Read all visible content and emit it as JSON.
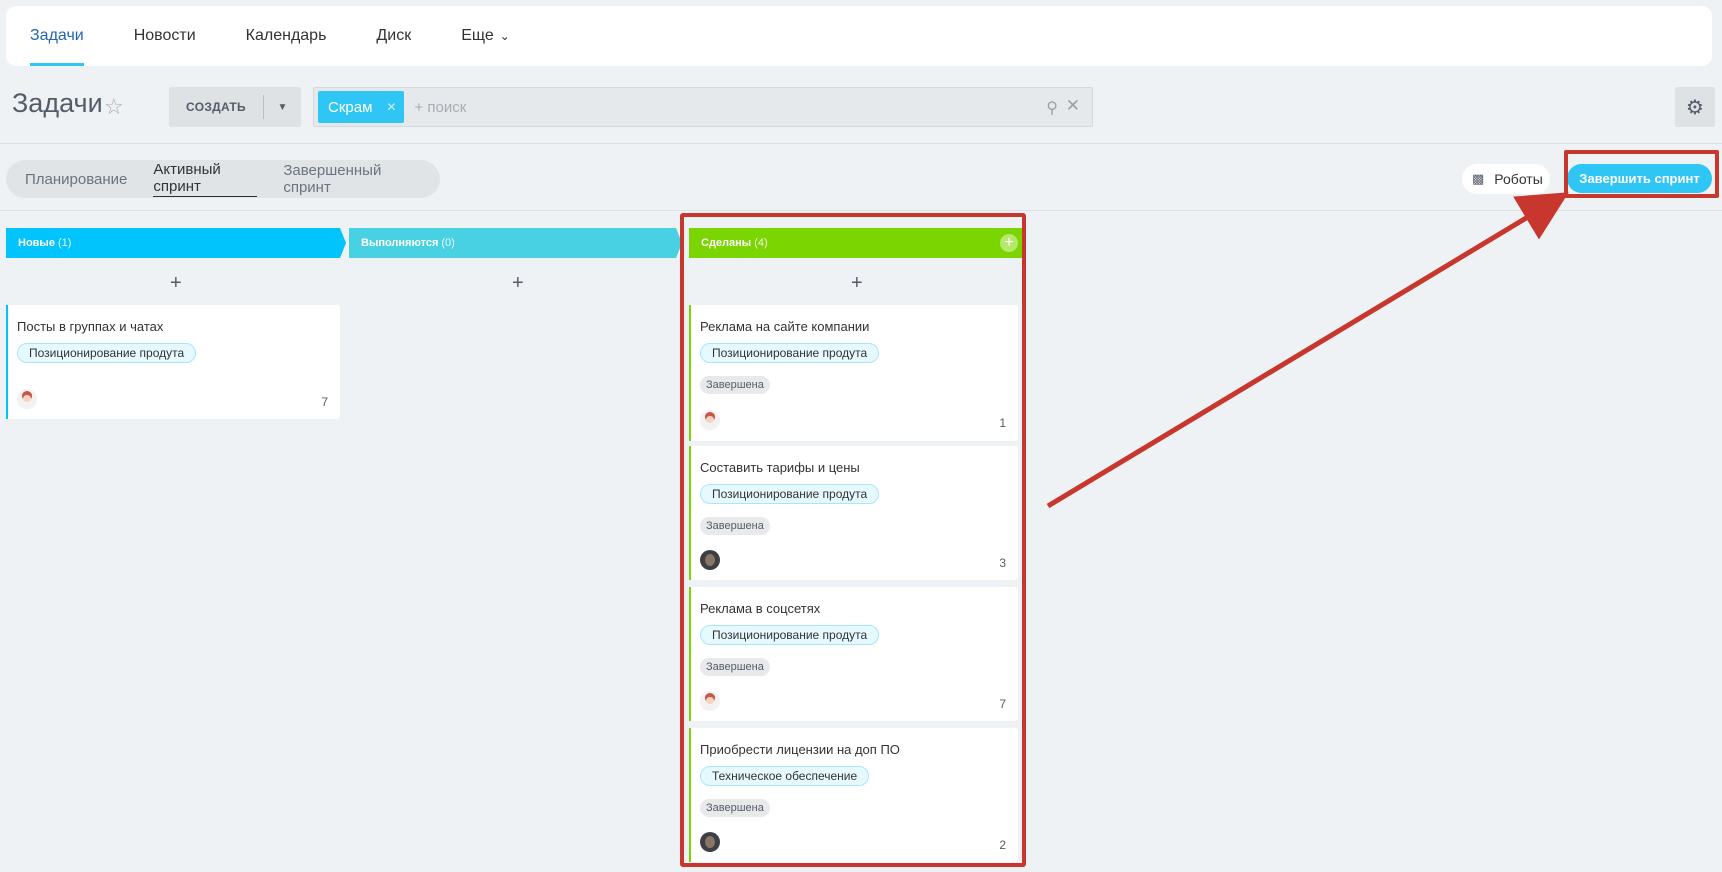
{
  "nav": {
    "items": [
      "Задачи",
      "Новости",
      "Календарь",
      "Диск",
      "Еще"
    ]
  },
  "header": {
    "title": "Задачи",
    "create_label": "СОЗДАТЬ",
    "filter_chip": "Скрам",
    "search_placeholder": "+ поиск"
  },
  "tabs": [
    "Планирование",
    "Активный спринт",
    "Завершенный спринт"
  ],
  "actions": {
    "robots_label": "Роботы",
    "finish_sprint_label": "Завершить спринт"
  },
  "columns": [
    {
      "title": "Новые",
      "count": "(1)",
      "color": "#00c4fb",
      "cards": [
        {
          "title": "Посты в группах и чатах",
          "tag": "Позиционирование продута",
          "status": "",
          "number": "7",
          "avatar": "girl-avatar"
        }
      ]
    },
    {
      "title": "Выполняются",
      "count": "(0)",
      "color": "#47d1e2",
      "cards": []
    },
    {
      "title": "Сделаны",
      "count": "(4)",
      "color": "#7bd500",
      "cards": [
        {
          "title": "Реклама на сайте компании",
          "tag": "Позиционирование продута",
          "status": "Завершена",
          "number": "1",
          "avatar": "girl-avatar"
        },
        {
          "title": "Составить тарифы и цены",
          "tag": "Позиционирование продута",
          "status": "Завершена",
          "number": "3",
          "avatar": "photo-avatar"
        },
        {
          "title": "Реклама в соцсетях",
          "tag": "Позиционирование продута",
          "status": "Завершена",
          "number": "7",
          "avatar": "girl-avatar"
        },
        {
          "title": "Приобрести лицензии на доп ПО",
          "tag": "Техническое обеспечение",
          "status": "Завершена",
          "number": "2",
          "avatar": "photo-avatar"
        }
      ]
    }
  ],
  "colors": {
    "accent": "#2fc6f6",
    "annotation": "#c8372d"
  }
}
